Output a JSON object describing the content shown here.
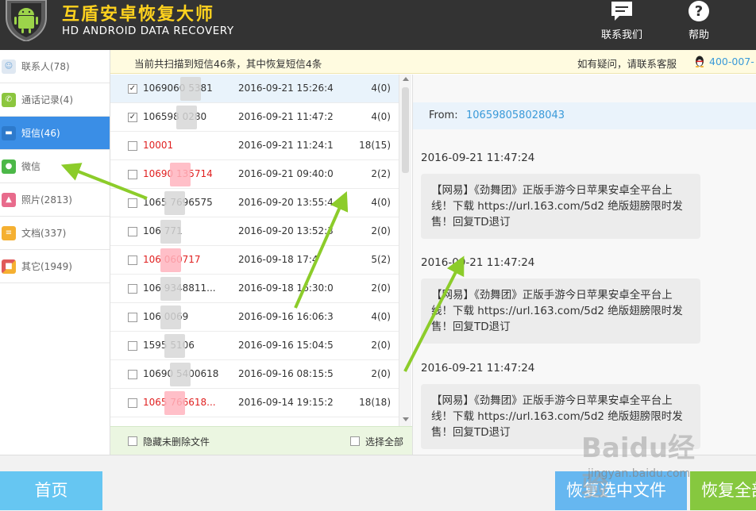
{
  "header": {
    "title": "互盾安卓恢复大师",
    "subtitle": "HD ANDROID DATA RECOVERY",
    "contact_label": "联系我们",
    "help_label": "帮助"
  },
  "sidebar": {
    "items": [
      {
        "label": "联系人(78)",
        "icon": "contacts-icon",
        "color": "#6fa6d8"
      },
      {
        "label": "通话记录(4)",
        "icon": "phone-icon",
        "color": "#8cc63f"
      },
      {
        "label": "短信(46)",
        "icon": "sms-icon",
        "color": "#3a8ee6"
      },
      {
        "label": "微信",
        "icon": "wechat-icon",
        "color": "#4cb848"
      },
      {
        "label": "照片(2813)",
        "icon": "photo-icon",
        "color": "#e86b8c"
      },
      {
        "label": "文档(337)",
        "icon": "document-icon",
        "color": "#f5b031"
      },
      {
        "label": "其它(1949)",
        "icon": "other-icon",
        "color": "#e05a5a"
      }
    ]
  },
  "banner": {
    "scan_text": "当前共扫描到短信46条，其中恢复短信4条",
    "help_text": "如有疑问，请联系客服",
    "phone": "400-007-"
  },
  "list": {
    "rows": [
      {
        "number": "1069060    5381",
        "date": "2016-09-21 15:26:4",
        "count": "4(0)",
        "checked": true,
        "red": false
      },
      {
        "number": "106598    0280",
        "date": "2016-09-21 11:47:2",
        "count": "4(0)",
        "checked": true,
        "red": false
      },
      {
        "number": "10001",
        "date": "2016-09-21 11:24:1",
        "count": "18(15)",
        "checked": false,
        "red": true
      },
      {
        "number": "10690    135714",
        "date": "2016-09-21 09:40:0",
        "count": "2(2)",
        "checked": false,
        "red": true
      },
      {
        "number": "1065    7696575",
        "date": "2016-09-20 13:55:4",
        "count": "4(0)",
        "checked": false,
        "red": false
      },
      {
        "number": "106    771",
        "date": "2016-09-20 13:52:3",
        "count": "2(0)",
        "checked": false,
        "red": false
      },
      {
        "number": "106    060717",
        "date": "2016-09-18 17:4",
        "count": "5(2)",
        "checked": false,
        "red": true
      },
      {
        "number": "106    9348811...",
        "date": "2016-09-18 16:30:0",
        "count": "2(0)",
        "checked": false,
        "red": false
      },
      {
        "number": "106    0069",
        "date": "2016-09-16 16:06:3",
        "count": "4(0)",
        "checked": false,
        "red": false
      },
      {
        "number": "1595    5106",
        "date": "2016-09-16 15:04:5",
        "count": "2(0)",
        "checked": false,
        "red": false
      },
      {
        "number": "10690    5400618",
        "date": "2016-09-16 08:15:5",
        "count": "2(0)",
        "checked": false,
        "red": false
      },
      {
        "number": "1065    766618...",
        "date": "2016-09-14 19:15:2",
        "count": "18(18)",
        "checked": false,
        "red": true
      }
    ],
    "hide_label": "隐藏未删除文件",
    "select_all_label": "选择全部"
  },
  "detail": {
    "from_label": "From:",
    "from_value": "106598058028043",
    "messages": [
      {
        "time": "2016-09-21 11:47:24",
        "text": "【网易】《劲舞团》正版手游今日苹果安卓全平台上线！下载 https://url.163.com/5d2 绝版翅膀限时发售！回复TD退订"
      },
      {
        "time": "2016-09-21 11:47:24",
        "text": "【网易】《劲舞团》正版手游今日苹果安卓全平台上线！下载 https://url.163.com/5d2 绝版翅膀限时发售！回复TD退订"
      },
      {
        "time": "2016-09-21 11:47:24",
        "text": "【网易】《劲舞团》正版手游今日苹果安卓全平台上线！下载 https://url.163.com/5d2 绝版翅膀限时发售！回复TD退订"
      }
    ]
  },
  "bottom": {
    "home_label": "首页",
    "recover_selected_label": "恢复选中文件",
    "recover_all_label": "恢复全部"
  },
  "watermark": {
    "text": "Baidu经验",
    "sub": "jingyan.baidu.com"
  },
  "colors": {
    "header_bg": "#333333",
    "title_yellow": "#ffd21e",
    "active_blue": "#3a8ee6",
    "link_blue": "#3a9ad9",
    "arrow_green": "#8ccc2a"
  }
}
